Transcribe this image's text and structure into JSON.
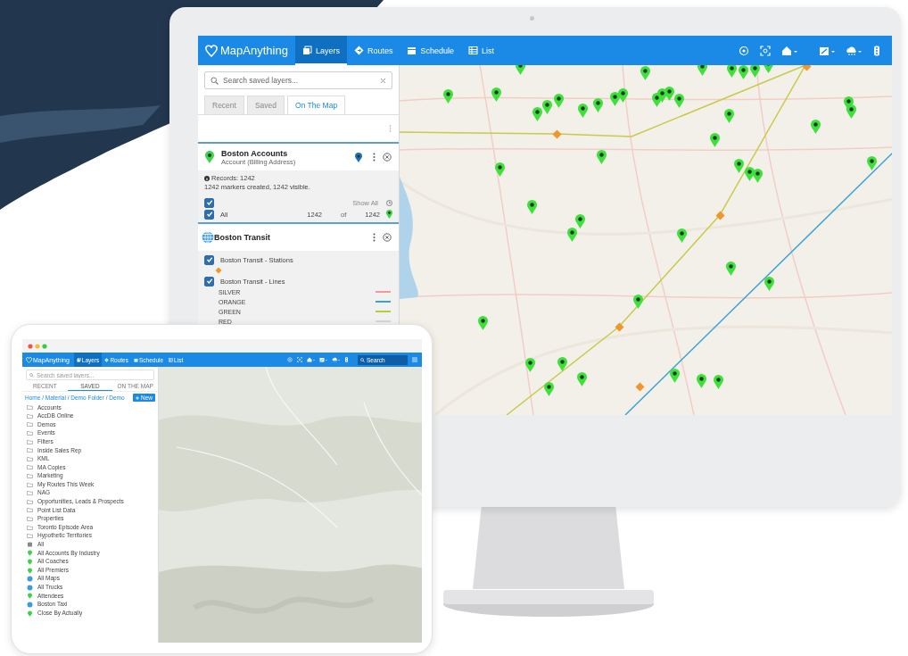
{
  "monitor": {
    "app": {
      "logo": "MapAnything",
      "nav": [
        {
          "label": "Layers",
          "selected": true
        },
        {
          "label": "Routes",
          "selected": false
        },
        {
          "label": "Schedule",
          "selected": false
        },
        {
          "label": "List",
          "selected": false
        }
      ]
    },
    "sidebar": {
      "search": {
        "placeholder": "Search saved layers..."
      },
      "tabs": [
        {
          "label": "Recent",
          "selected": false
        },
        {
          "label": "Saved",
          "selected": false
        },
        {
          "label": "On The Map",
          "selected": true
        }
      ],
      "layers": [
        {
          "kind": "marker",
          "title": "Boston Accounts",
          "subtitle": "Account (Billing Address)",
          "records": "Records: 1242",
          "summary": "1242 markers created, 1242 visible.",
          "show_all": "Show All",
          "show_all_checked": true,
          "rows": [
            {
              "label": "All",
              "checked": true,
              "count": "1242",
              "of": "of",
              "total": "1242"
            }
          ]
        },
        {
          "kind": "data",
          "title": "Boston Transit",
          "groups": [
            {
              "label": "Boston Transit - Stations",
              "checked": true,
              "kind": "stations"
            },
            {
              "label": "Boston Transit - Lines",
              "checked": true,
              "kind": "lines",
              "lines": [
                {
                  "label": "SILVER",
                  "color": "#f29a9a"
                },
                {
                  "label": "ORANGE",
                  "color": "#3aa3d4"
                },
                {
                  "label": "GREEN",
                  "color": "#b5cf3a"
                },
                {
                  "label": "RED",
                  "color": "#d6d6d6"
                }
              ]
            }
          ]
        }
      ]
    }
  },
  "tablet": {
    "app": {
      "logo": "MapAnything",
      "nav": [
        {
          "label": "Layers",
          "selected": true
        },
        {
          "label": "Routes",
          "selected": false
        },
        {
          "label": "Schedule",
          "selected": false
        },
        {
          "label": "List",
          "selected": false
        }
      ],
      "search": {
        "placeholder": "Search"
      }
    },
    "sidebar": {
      "search": {
        "placeholder": "Search saved layers..."
      },
      "tabs": [
        {
          "label": "RECENT",
          "selected": false
        },
        {
          "label": "SAVED",
          "selected": true
        },
        {
          "label": "ON THE MAP",
          "selected": false
        }
      ],
      "breadcrumb": "Home / Material / Demo Folder / Demo",
      "new_button": "New",
      "items": [
        {
          "kind": "folder",
          "label": "Accounts"
        },
        {
          "kind": "folder",
          "label": "AccDB Online"
        },
        {
          "kind": "folder",
          "label": "Demos"
        },
        {
          "kind": "folder",
          "label": "Events"
        },
        {
          "kind": "folder",
          "label": "Filters"
        },
        {
          "kind": "folder",
          "label": "Inside Sales Rep"
        },
        {
          "kind": "folder",
          "label": "KML"
        },
        {
          "kind": "folder",
          "label": "MA Copies"
        },
        {
          "kind": "folder",
          "label": "Marketing"
        },
        {
          "kind": "folder",
          "label": "My Routes This Week"
        },
        {
          "kind": "folder",
          "label": "NAG"
        },
        {
          "kind": "folder",
          "label": "Opportunities, Leads & Prospects"
        },
        {
          "kind": "folder",
          "label": "Point List Data"
        },
        {
          "kind": "folder",
          "label": "Properties"
        },
        {
          "kind": "folder",
          "label": "Toronto Episode Area"
        },
        {
          "kind": "folder",
          "label": "Hypothetic Territories"
        },
        {
          "kind": "data",
          "label": "All"
        },
        {
          "kind": "marker",
          "label": "All Accounts By Industry"
        },
        {
          "kind": "marker",
          "label": "All Coaches"
        },
        {
          "kind": "marker",
          "label": "All Premiers"
        },
        {
          "kind": "layer",
          "label": "All Maps"
        },
        {
          "kind": "layer",
          "label": "All Trucks"
        },
        {
          "kind": "marker",
          "label": "Attendees"
        },
        {
          "kind": "layer",
          "label": "Boston Taxi"
        },
        {
          "kind": "marker",
          "label": "Close By Actually"
        }
      ]
    }
  }
}
